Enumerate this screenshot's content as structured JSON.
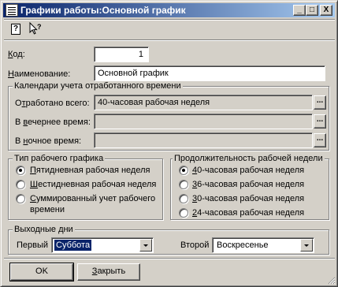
{
  "window": {
    "title": "Графики работы:Основной график",
    "controls": {
      "minimize": "_",
      "maximize": "□",
      "close": "X"
    }
  },
  "toolbar": {
    "help_icon_glyph": "?"
  },
  "code": {
    "label_u": "К",
    "label_rest": "од:",
    "value": "1"
  },
  "name": {
    "label_u": "Н",
    "label_rest": "аименование:",
    "value": "Основной график"
  },
  "calendars": {
    "title": "Календари учета отработанного времени",
    "total": {
      "label_pre": "О",
      "label_u": "т",
      "label_rest": "работано всего:",
      "value": "40-часовая рабочая неделя"
    },
    "evening": {
      "label_pre": "В ",
      "label_u": "в",
      "label_rest": "ечернее время:",
      "value": ""
    },
    "night": {
      "label_pre": "В ",
      "label_u": "н",
      "label_rest": "очное время:",
      "value": ""
    },
    "ellipsis": "..."
  },
  "schedule_type": {
    "title": "Тип рабочего графика",
    "options": [
      {
        "u": "П",
        "rest": "ятидневная рабочая неделя",
        "selected": true
      },
      {
        "u": "Ш",
        "rest": "естидневная рабочая неделя",
        "selected": false
      },
      {
        "u": "С",
        "rest": "уммированный учет рабочего",
        "line2": "времени",
        "selected": false
      }
    ]
  },
  "week_length": {
    "title": "Продолжительность рабочей недели",
    "options": [
      {
        "u": "4",
        "rest": "0-часовая рабочая неделя",
        "selected": true
      },
      {
        "u": "3",
        "rest": "6-часовая рабочая неделя",
        "selected": false
      },
      {
        "u": "3",
        "rest": "0-часовая рабочая неделя",
        "selected": false
      },
      {
        "u": "2",
        "rest": "4-часовая рабочая неделя",
        "selected": false
      }
    ]
  },
  "days_off": {
    "title": "Выходные дни",
    "first": {
      "label": "Первый",
      "value": "Суббота"
    },
    "second": {
      "label": "Второй",
      "value": "Воскресенье"
    }
  },
  "buttons": {
    "ok": "OK",
    "close_u": "З",
    "close_rest": "акрыть"
  },
  "colors": {
    "face": "#d4d0c8",
    "title_active": "#0a246a",
    "selection": "#0a246a"
  }
}
